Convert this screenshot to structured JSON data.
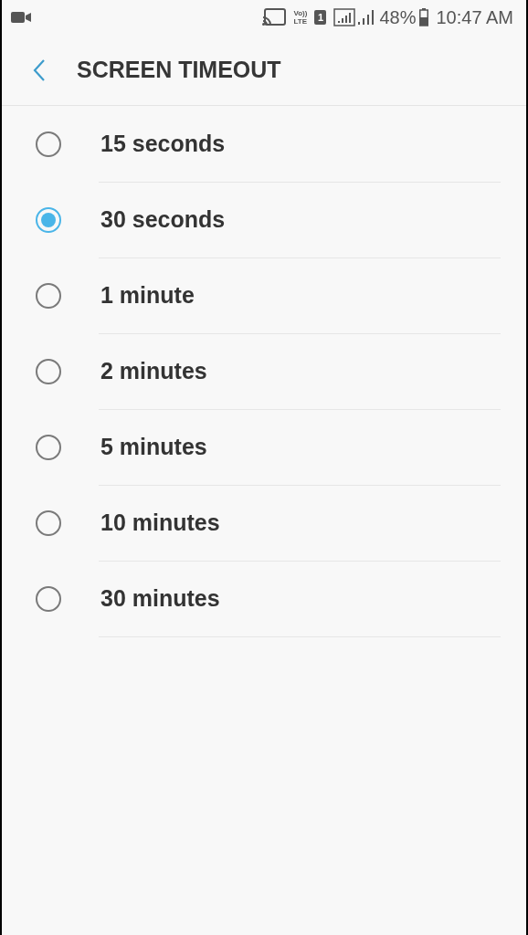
{
  "status_bar": {
    "volte_label": "Vo))",
    "lte_label": "LTE",
    "sim_slot": "1",
    "battery": "48%",
    "time": "10:47 AM"
  },
  "header": {
    "title": "SCREEN TIMEOUT"
  },
  "options": [
    {
      "label": "15 seconds",
      "selected": false
    },
    {
      "label": "30 seconds",
      "selected": true
    },
    {
      "label": "1 minute",
      "selected": false
    },
    {
      "label": "2 minutes",
      "selected": false
    },
    {
      "label": "5 minutes",
      "selected": false
    },
    {
      "label": "10 minutes",
      "selected": false
    },
    {
      "label": "30 minutes",
      "selected": false
    }
  ]
}
